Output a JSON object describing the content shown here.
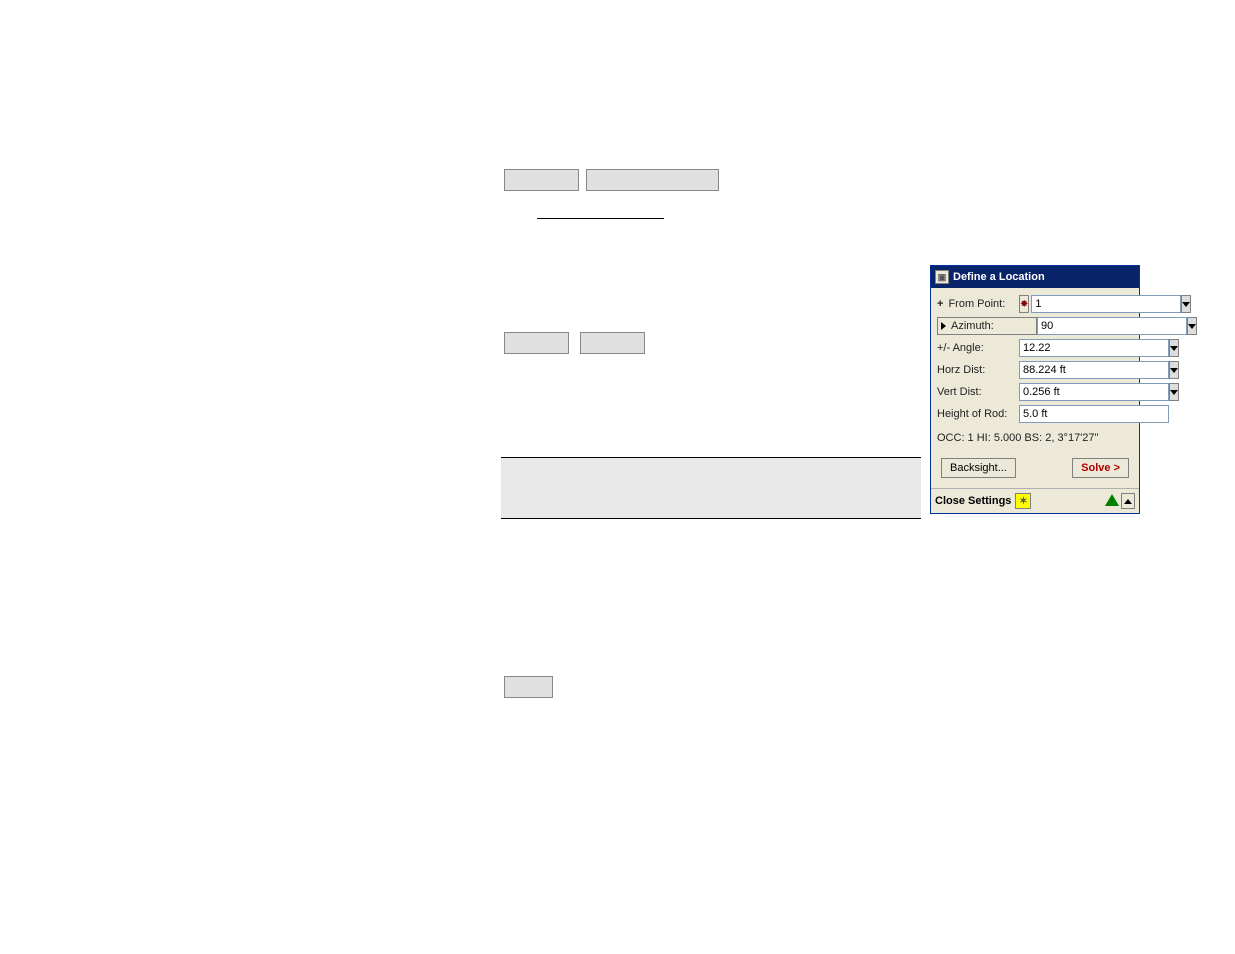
{
  "dialog": {
    "title": "Define a Location",
    "fields": {
      "from_point": {
        "label": "From Point:",
        "value": "1"
      },
      "azimuth": {
        "label": "Azimuth:",
        "value": "90"
      },
      "angle": {
        "label": "+/- Angle:",
        "value": "12.22"
      },
      "horz_dist": {
        "label": "Horz Dist:",
        "value": "88.224 ft"
      },
      "vert_dist": {
        "label": "Vert Dist:",
        "value": "0.256 ft"
      },
      "height_rod": {
        "label": "Height of Rod:",
        "value": "5.0 ft"
      }
    },
    "status": "OCC: 1  HI: 5.000  BS: 2, 3°17'27\"",
    "buttons": {
      "backsight": "Backsight...",
      "solve": "Solve >"
    },
    "bottom": {
      "close_settings": "Close Settings"
    }
  }
}
